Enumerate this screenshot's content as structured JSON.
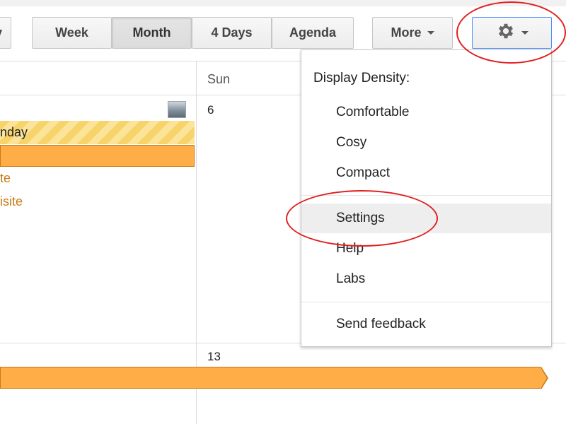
{
  "toolbar": {
    "day_label": "y",
    "week_label": "Week",
    "month_label": "Month",
    "four_days_label": "4 Days",
    "agenda_label": "Agenda",
    "more_label": "More"
  },
  "calendar": {
    "day_header": "Sun",
    "date_6": "6",
    "date_13": "13",
    "event_striped_text": "nday",
    "event_text_1": "te",
    "event_text_2": "isite"
  },
  "settings_menu": {
    "heading": "Display Density:",
    "items": [
      {
        "label": "Comfortable"
      },
      {
        "label": "Cosy"
      },
      {
        "label": "Compact"
      },
      {
        "label": "Settings"
      },
      {
        "label": "Help"
      },
      {
        "label": "Labs"
      },
      {
        "label": "Send feedback"
      }
    ],
    "hovered": "Settings"
  },
  "colors": {
    "event_orange": "#ffad46",
    "event_yellow": "#f7d469",
    "event_text": "#c67c12",
    "annotation_red": "#e02020",
    "focus_blue": "#4d90fe"
  },
  "icons": {
    "gear": "gear-icon",
    "caret": "chevron-down-icon",
    "weather": "weather-icon"
  }
}
